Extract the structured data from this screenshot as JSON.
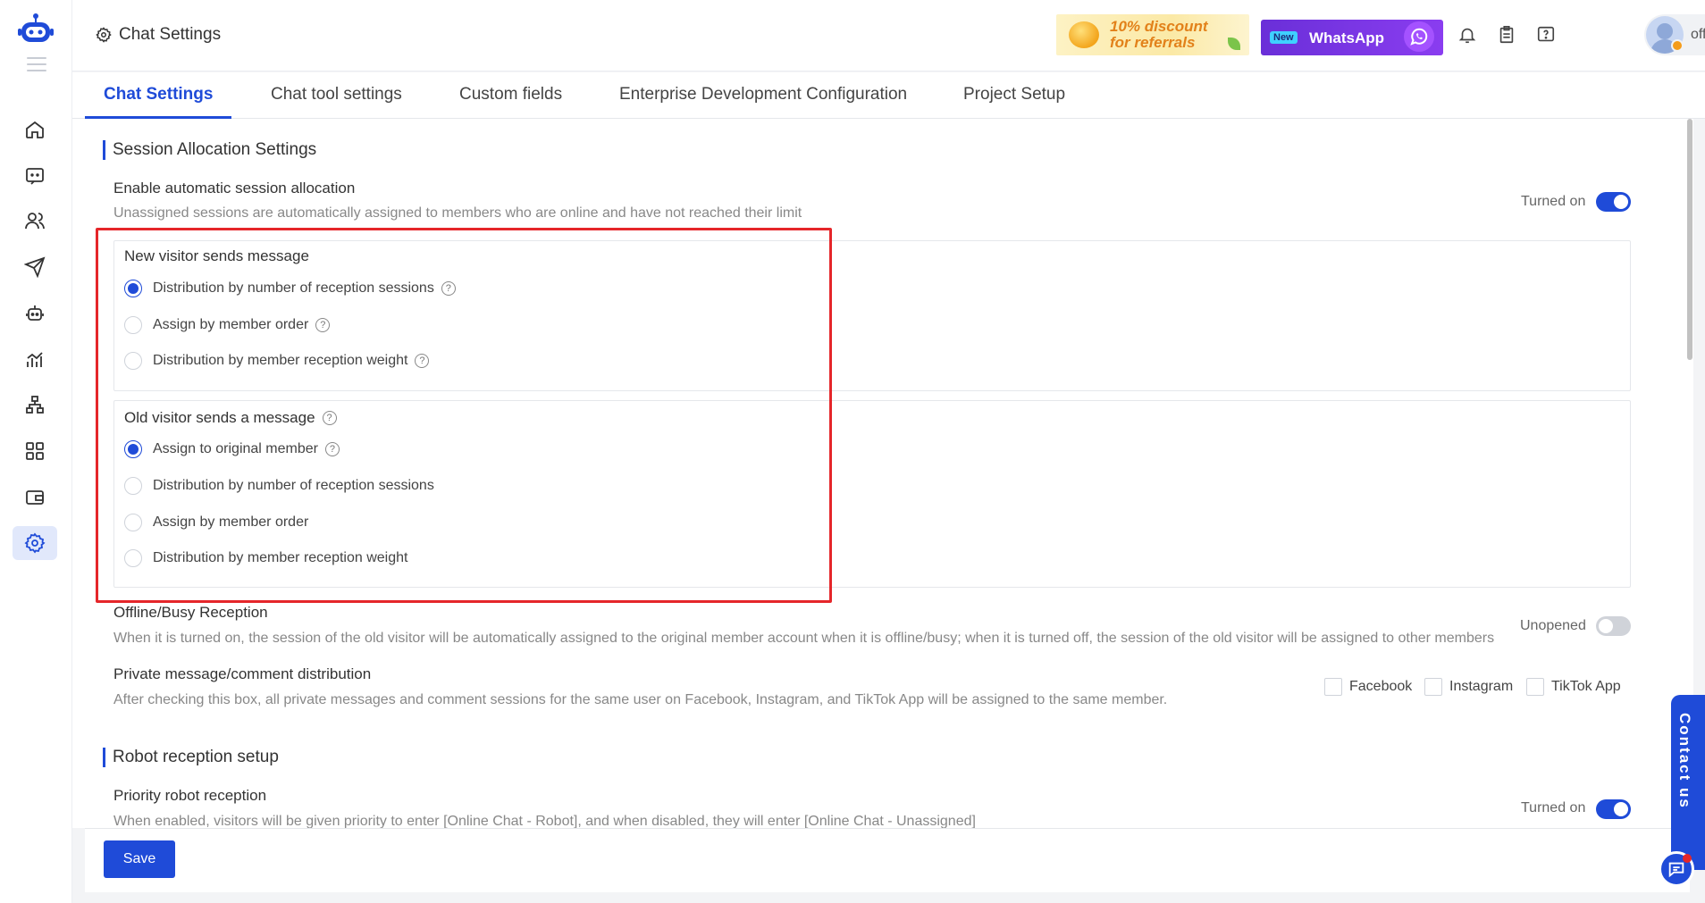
{
  "header": {
    "title": "Chat Settings",
    "promo_referral_line1": "10% discount",
    "promo_referral_line2": "for referrals",
    "promo_whatsapp_badge": "New",
    "promo_whatsapp_label": "WhatsApp",
    "user_status": "offline"
  },
  "tabs": [
    "Chat Settings",
    "Chat tool settings",
    "Custom fields",
    "Enterprise Development Configuration",
    "Project Setup"
  ],
  "session_allocation": {
    "section_title": "Session Allocation Settings",
    "auto_title": "Enable automatic session allocation",
    "auto_desc": "Unassigned sessions are automatically assigned to members who are online and have not reached their limit",
    "auto_status": "Turned on",
    "new_visitor": {
      "title": "New visitor sends message",
      "options": [
        "Distribution by number of reception sessions",
        "Assign by member order",
        "Distribution by member reception weight"
      ]
    },
    "old_visitor": {
      "title": "Old visitor sends a message",
      "options": [
        "Assign to original member",
        "Distribution by number of reception sessions",
        "Assign by member order",
        "Distribution by member reception weight"
      ]
    },
    "offline_title": "Offline/Busy Reception",
    "offline_desc": "When it is turned on, the session of the old visitor will be automatically assigned to the original member account when it is offline/busy; when it is turned off, the session of the old visitor will be assigned to other members",
    "offline_status": "Unopened",
    "private_title": "Private message/comment distribution",
    "private_desc": "After checking this box, all private messages and comment sessions for the same user on Facebook, Instagram, and TikTok App will be assigned to the same member.",
    "platforms": [
      "Facebook",
      "Instagram",
      "TikTok App"
    ]
  },
  "robot": {
    "section_title": "Robot reception setup",
    "priority_title": "Priority robot reception",
    "priority_desc": "When enabled, visitors will be given priority to enter [Online Chat - Robot], and when disabled, they will enter [Online Chat - Unassigned]",
    "priority_status": "Turned on"
  },
  "footer": {
    "save_label": "Save"
  },
  "contact_label": "Contact us",
  "colors": {
    "accent": "#1f4bd8",
    "highlight": "#e5262a"
  }
}
